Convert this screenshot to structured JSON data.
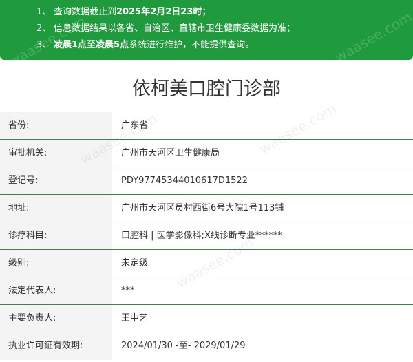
{
  "notice": {
    "lines": [
      {
        "num": "1、",
        "pre": "查询数据截止到",
        "bold": "2025年2月2日23时",
        "post": "；"
      },
      {
        "num": "2、",
        "pre": "信息数据结果以各省、自治区、直辖市卫生健康委数据为准；",
        "bold": "",
        "post": ""
      },
      {
        "num": "3、",
        "pre": "",
        "bold": "凌晨1点至凌晨5点",
        "post": "系统进行维护，不能提供查询。"
      }
    ],
    "color": "#1f9a3c"
  },
  "title": "依柯美口腔门诊部",
  "rows": [
    {
      "label": "省份:",
      "value": "广东省"
    },
    {
      "label": "审批机关:",
      "value": "广州市天河区卫生健康局"
    },
    {
      "label": "登记号:",
      "value": "PDY97745344010617D1522"
    },
    {
      "label": "地址:",
      "value": "广州市天河区员村西街6号大院1号113铺"
    },
    {
      "label": "诊疗科目:",
      "value": "口腔科 | 医学影像科;X线诊断专业******"
    },
    {
      "label": "级别:",
      "value": "未定级"
    },
    {
      "label": "法定代表人:",
      "value": "***"
    },
    {
      "label": "主要负责人:",
      "value": "王中艺"
    },
    {
      "label": "执业许可证有效期:",
      "value": "2024/01/30 -至- 2029/01/29"
    }
  ],
  "watermark": "waasee.com"
}
